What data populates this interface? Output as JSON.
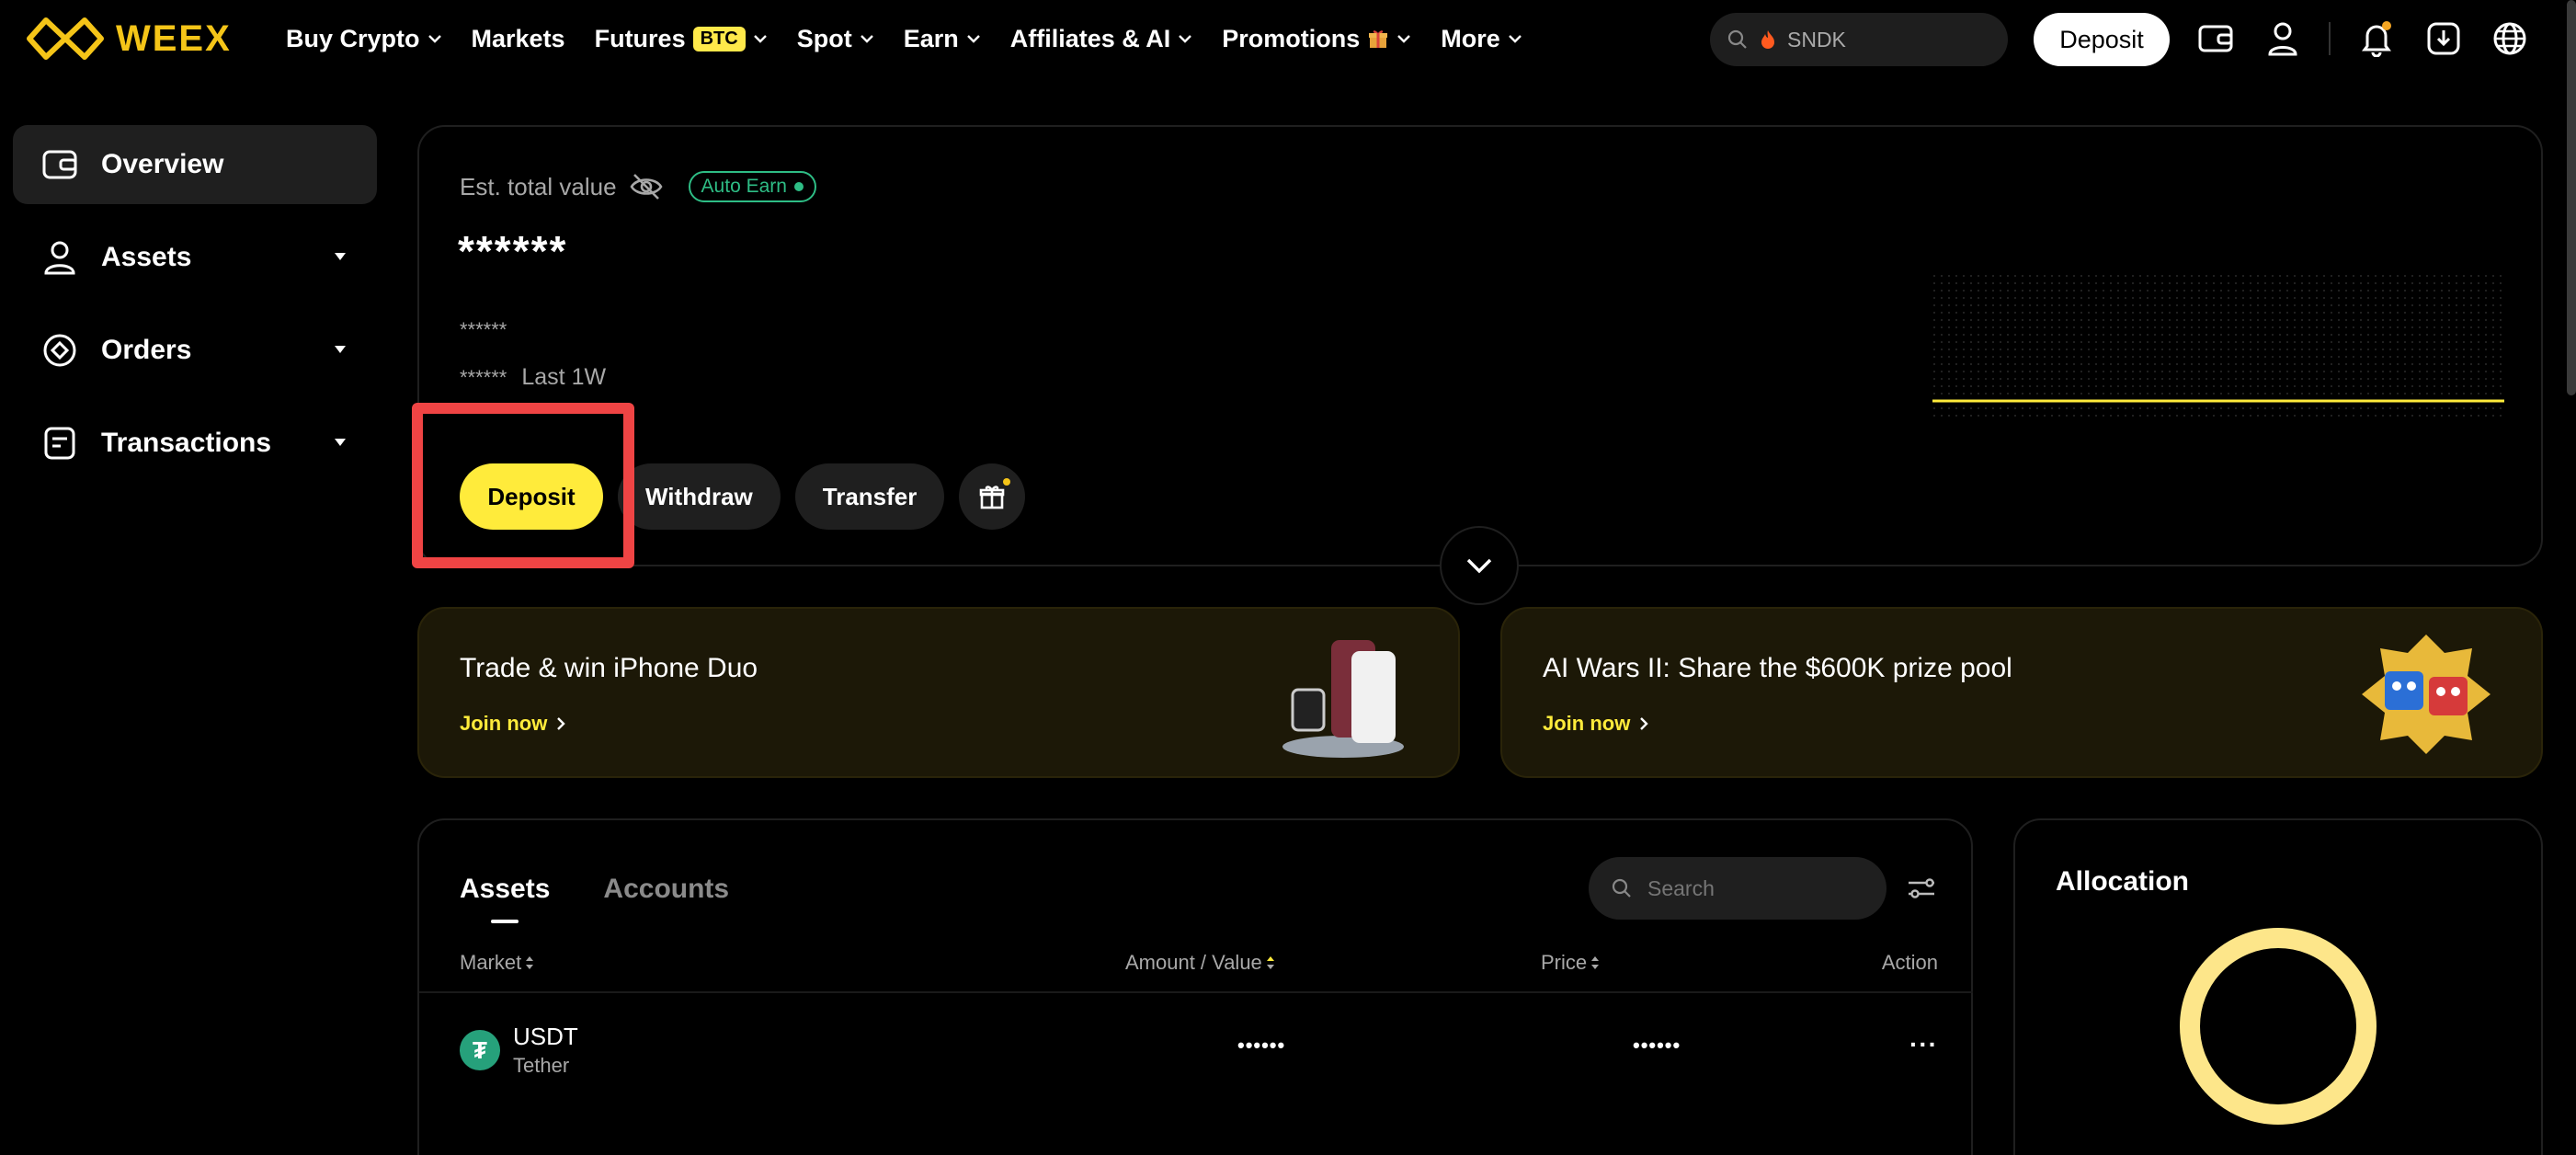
{
  "brand": {
    "name": "WEEX",
    "color": "#f5c518"
  },
  "nav": {
    "items": [
      {
        "label": "Buy Crypto",
        "has_menu": true
      },
      {
        "label": "Markets",
        "has_menu": false
      },
      {
        "label": "Futures",
        "badge": "BTC",
        "has_menu": true
      },
      {
        "label": "Spot",
        "has_menu": true
      },
      {
        "label": "Earn",
        "has_menu": true
      },
      {
        "label": "Affiliates & AI",
        "has_menu": true
      },
      {
        "label": "Promotions",
        "has_menu": true,
        "icon": "gift-emoji-icon"
      },
      {
        "label": "More",
        "has_menu": true
      }
    ],
    "search_value": "SNDK",
    "deposit_label": "Deposit",
    "icons": [
      "wallet-icon",
      "user-icon",
      "bell-icon",
      "download-icon",
      "globe-icon"
    ]
  },
  "sidebar": {
    "items": [
      {
        "label": "Overview",
        "icon": "wallet-icon",
        "active": true
      },
      {
        "label": "Assets",
        "icon": "user-icon",
        "expandable": true
      },
      {
        "label": "Orders",
        "icon": "orders-icon",
        "expandable": true
      },
      {
        "label": "Transactions",
        "icon": "transactions-icon",
        "expandable": true
      }
    ]
  },
  "overview": {
    "est_label": "Est. total value",
    "auto_earn_label": "Auto Earn",
    "total_value": "******",
    "sub_value": "******",
    "pnl_value": "******",
    "pnl_period": "Last 1W",
    "buttons": {
      "deposit": "Deposit",
      "withdraw": "Withdraw",
      "transfer": "Transfer"
    },
    "accent_color": "#ffeb3b",
    "highlight_color": "#ef4444"
  },
  "promos": [
    {
      "title": "Trade & win iPhone Duo",
      "link": "Join now"
    },
    {
      "title": "AI Wars II: Share the $600K prize pool",
      "link": "Join now"
    }
  ],
  "assets": {
    "tabs": [
      "Assets",
      "Accounts"
    ],
    "search_placeholder": "Search",
    "columns": {
      "market": "Market",
      "amount": "Amount / Value",
      "price": "Price",
      "action": "Action"
    },
    "rows": [
      {
        "symbol": "USDT",
        "name": "Tether",
        "amount": "••••••",
        "price": "••••••",
        "action": "···"
      }
    ]
  },
  "allocation": {
    "title": "Allocation",
    "ring_color": "#fde68a"
  }
}
